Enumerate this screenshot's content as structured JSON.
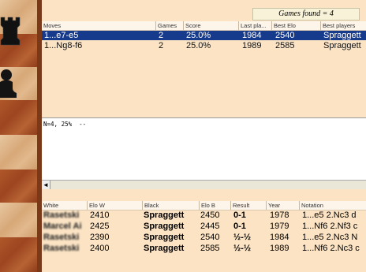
{
  "board": {
    "pieces": [
      "black-rook-icon",
      "black-pawn-icon"
    ]
  },
  "games_found_label": "Games found = 4",
  "moves_table": {
    "columns": [
      "Moves",
      "Games",
      "Score",
      "Last pla...",
      "Best Elo",
      "Best players"
    ],
    "rows": [
      {
        "move": "1...e7-e5",
        "games": "2",
        "score": "25.0%",
        "last": "1984",
        "elo": "2540",
        "player": "Spraggett",
        "selected": true
      },
      {
        "move": "1...Ng8-f6",
        "games": "2",
        "score": "25.0%",
        "last": "1989",
        "elo": "2585",
        "player": "Spraggett",
        "selected": false
      }
    ]
  },
  "stats_text": "N=4, 25%  --",
  "scroll_left_arrow": "◄",
  "games_table": {
    "columns": [
      "White",
      "Elo W",
      "Black",
      "Elo B",
      "Result",
      "Year",
      "Notation"
    ],
    "rows": [
      {
        "white": "Rasetski",
        "elo_w": "2410",
        "black": "Spraggett",
        "elo_b": "2450",
        "result": "0-1",
        "year": "1978",
        "notation": "1...e5 2.Nc3 d"
      },
      {
        "white": "Marcel Ai",
        "elo_w": "2425",
        "black": "Spraggett",
        "elo_b": "2445",
        "result": "0-1",
        "year": "1979",
        "notation": "1...Nf6 2.Nf3 c"
      },
      {
        "white": "Rasetski",
        "elo_w": "2390",
        "black": "Spraggett",
        "elo_b": "2540",
        "result": "½-½",
        "year": "1984",
        "notation": "1...e5 2.Nc3 N"
      },
      {
        "white": "Rasetski",
        "elo_w": "2400",
        "black": "Spraggett",
        "elo_b": "2585",
        "result": "½-½",
        "year": "1989",
        "notation": "1...Nf6 2.Nc3 c"
      }
    ]
  }
}
